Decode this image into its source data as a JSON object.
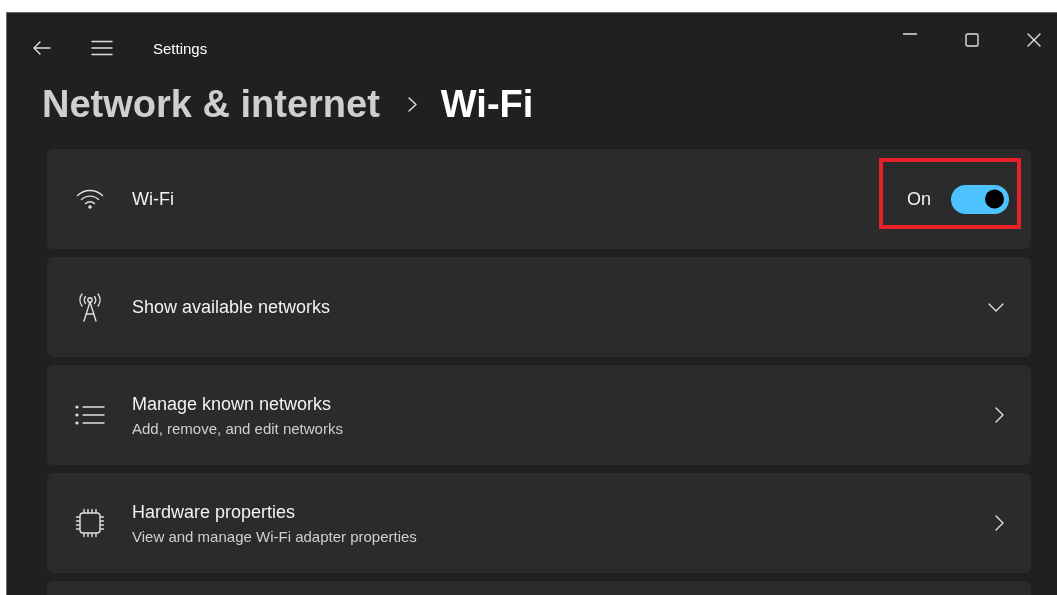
{
  "window": {
    "title": "Settings"
  },
  "breadcrumb": {
    "parent": "Network & internet",
    "current": "Wi-Fi"
  },
  "settings": [
    {
      "kind": "toggle",
      "title": "Wi-Fi",
      "state_label": "On",
      "on": true,
      "highlighted": true
    },
    {
      "kind": "expander",
      "title": "Show available networks",
      "expanded": false
    },
    {
      "kind": "link",
      "title": "Manage known networks",
      "subtitle": "Add, remove, and edit networks"
    },
    {
      "kind": "link",
      "title": "Hardware properties",
      "subtitle": "View and manage Wi-Fi adapter properties"
    },
    {
      "kind": "partial"
    }
  ]
}
